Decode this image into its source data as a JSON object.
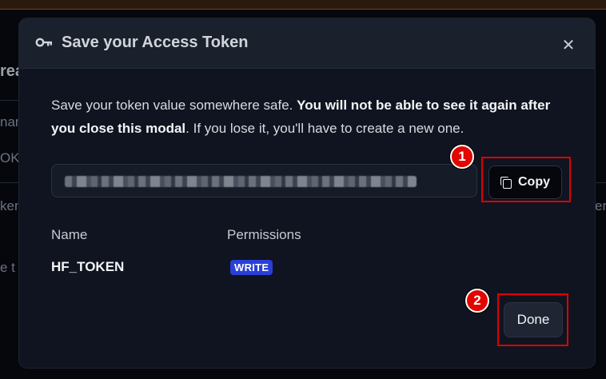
{
  "background": {
    "fragments": [
      "reat",
      "nam",
      "OK",
      "ken",
      "e t",
      "ere"
    ]
  },
  "modal": {
    "title": "Save your Access Token",
    "title_icon": "key-icon",
    "close_glyph": "✕",
    "intro": {
      "part1": "Save your token value somewhere safe. ",
      "bold1": "You will not be able to see it again after you close this modal",
      "part2": ". If you lose it, you'll have to create a new one."
    },
    "token_field": {
      "value_icon": "redacted-token"
    },
    "copy_button": {
      "label": "Copy",
      "icon": "copy-icon"
    },
    "table": {
      "headers": {
        "name": "Name",
        "permissions": "Permissions"
      },
      "row": {
        "name": "HF_TOKEN",
        "permission": "WRITE"
      }
    },
    "done_button": {
      "label": "Done"
    }
  },
  "annotations": {
    "markers": [
      {
        "number": "1"
      },
      {
        "number": "2"
      }
    ],
    "colors": {
      "highlight": "#e00000",
      "marker": "#e10600",
      "badge": "#2a3fd6"
    }
  }
}
